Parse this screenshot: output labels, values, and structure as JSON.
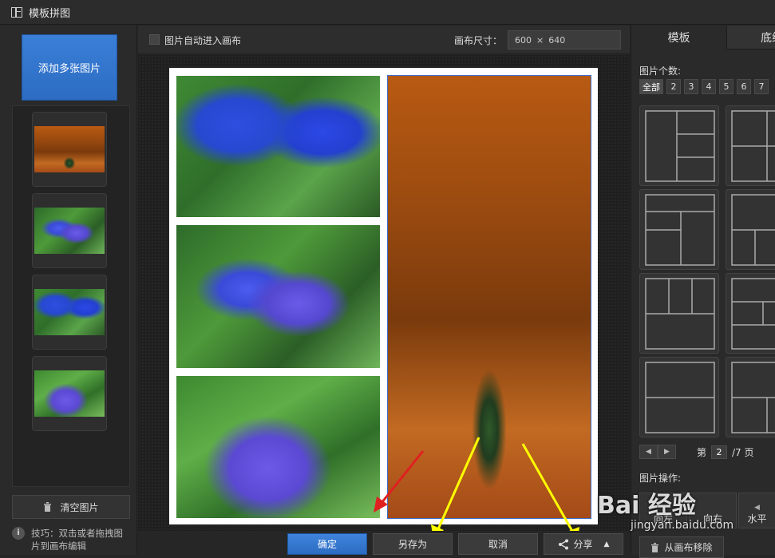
{
  "app": {
    "title": "模板拼图"
  },
  "left": {
    "add_label": "添加多张图片",
    "clear_label": "清空图片",
    "tip": "技巧：双击或者拖拽图片到画布编辑",
    "info_glyph": "i",
    "thumbs": [
      {
        "kind": "forest"
      },
      {
        "kind": "flower"
      },
      {
        "kind": "flower1"
      },
      {
        "kind": "flower3"
      }
    ]
  },
  "toolbar": {
    "auto_label": "图片自动进入画布",
    "size_label": "画布尺寸：",
    "width": "600",
    "times": "×",
    "height": "640"
  },
  "actions": {
    "confirm": "确定",
    "save_as": "另存为",
    "cancel": "取消",
    "share": "分享"
  },
  "right": {
    "tab_active": "模板",
    "tab_inactive": "底纹",
    "count_label": "图片个数:",
    "counts": [
      "全部",
      "2",
      "3",
      "4",
      "5",
      "6",
      "7"
    ],
    "page_prefix": "第",
    "page_current": "2",
    "page_suffix": "/7 页",
    "op_label": "图片操作:",
    "ops": [
      "向左",
      "向右",
      "水平"
    ],
    "remove_label": "从画布移除"
  },
  "watermark": {
    "text": "Bai 经验",
    "sub": "jingyan.baidu.com"
  },
  "colors": {
    "accent": "#2d6cc2",
    "annotation_red": "#e02020",
    "annotation_yellow": "#ffff00"
  }
}
